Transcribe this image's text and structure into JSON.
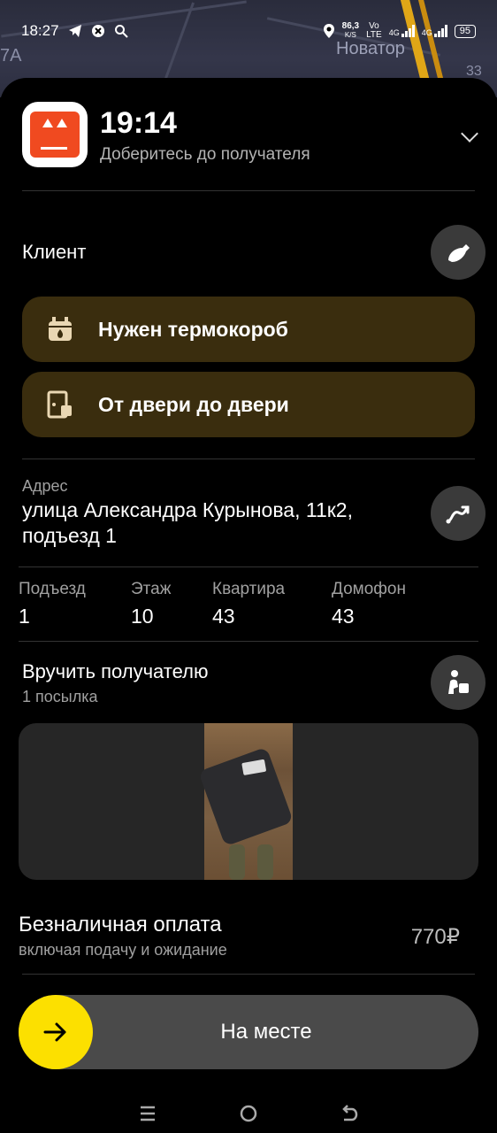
{
  "status_bar": {
    "time": "18:27",
    "net_speed_value": "86,3",
    "net_speed_unit": "K/S",
    "volte_top": "Vo",
    "volte_bottom": "LTE",
    "net_type_1": "4G",
    "net_type_2": "4G",
    "battery": "95"
  },
  "map": {
    "label_left": "7A",
    "label_center": "Новатор",
    "label_right": "33"
  },
  "header": {
    "eta_time": "19:14",
    "subtitle": "Доберитесь до получателя"
  },
  "client": {
    "title": "Клиент",
    "tags": [
      {
        "label": "Нужен термокороб",
        "icon": "thermobox-icon"
      },
      {
        "label": "От двери до двери",
        "icon": "door-to-door-icon"
      }
    ]
  },
  "address": {
    "label": "Адрес",
    "value": "улица Александра Курынова, 11к2, подъезд 1"
  },
  "details": [
    {
      "label": "Подъезд",
      "value": "1"
    },
    {
      "label": "Этаж",
      "value": "10"
    },
    {
      "label": "Квартира",
      "value": "43"
    },
    {
      "label": "Домофон",
      "value": "43"
    }
  ],
  "handover": {
    "title": "Вручить получателю",
    "subtitle": "1 посылка"
  },
  "payment": {
    "title": "Безналичная оплата",
    "subtitle": "включая подачу и ожидание",
    "amount": "770₽"
  },
  "action": {
    "label": "На месте"
  },
  "colors": {
    "accent_yellow": "#fce000",
    "tag_background": "#3a2d0e",
    "brand_orange": "#f04a20"
  }
}
